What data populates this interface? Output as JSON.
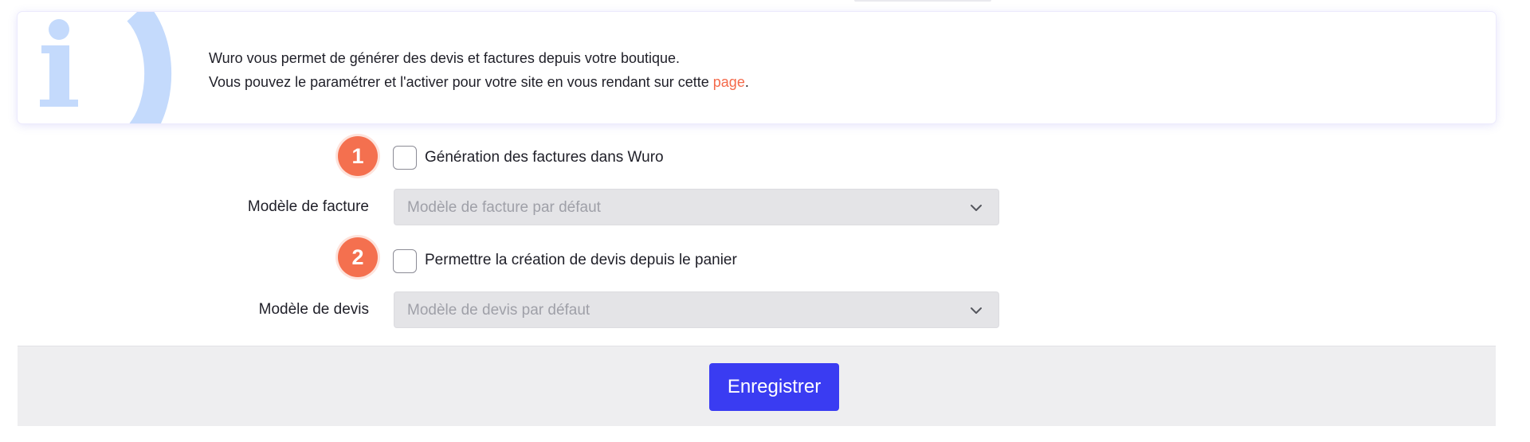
{
  "info": {
    "line1": "Wuro vous permet de générer des devis et factures depuis votre boutique.",
    "line2_prefix": "Vous pouvez le paramétrer et l'activer pour votre site en vous rendant sur cette ",
    "link_text": "page",
    "line2_suffix": ".",
    "icon": "info-icon"
  },
  "form": {
    "invoice_toggle": {
      "step": "1",
      "label": "Génération des factures dans Wuro",
      "checked": false
    },
    "invoice_template": {
      "label": "Modèle de facture",
      "placeholder": "Modèle de facture par défaut",
      "icon": "chevron-down-icon"
    },
    "quote_toggle": {
      "step": "2",
      "label": "Permettre la création de devis depuis le panier",
      "checked": false
    },
    "quote_template": {
      "label": "Modèle de devis",
      "placeholder": "Modèle de devis par défaut",
      "icon": "chevron-down-icon"
    }
  },
  "footer": {
    "save_label": "Enregistrer"
  },
  "colors": {
    "accent": "#3a3cf2",
    "badge": "#f4704f",
    "link": "#f46a4b",
    "info_icon": "#c4dafc"
  }
}
